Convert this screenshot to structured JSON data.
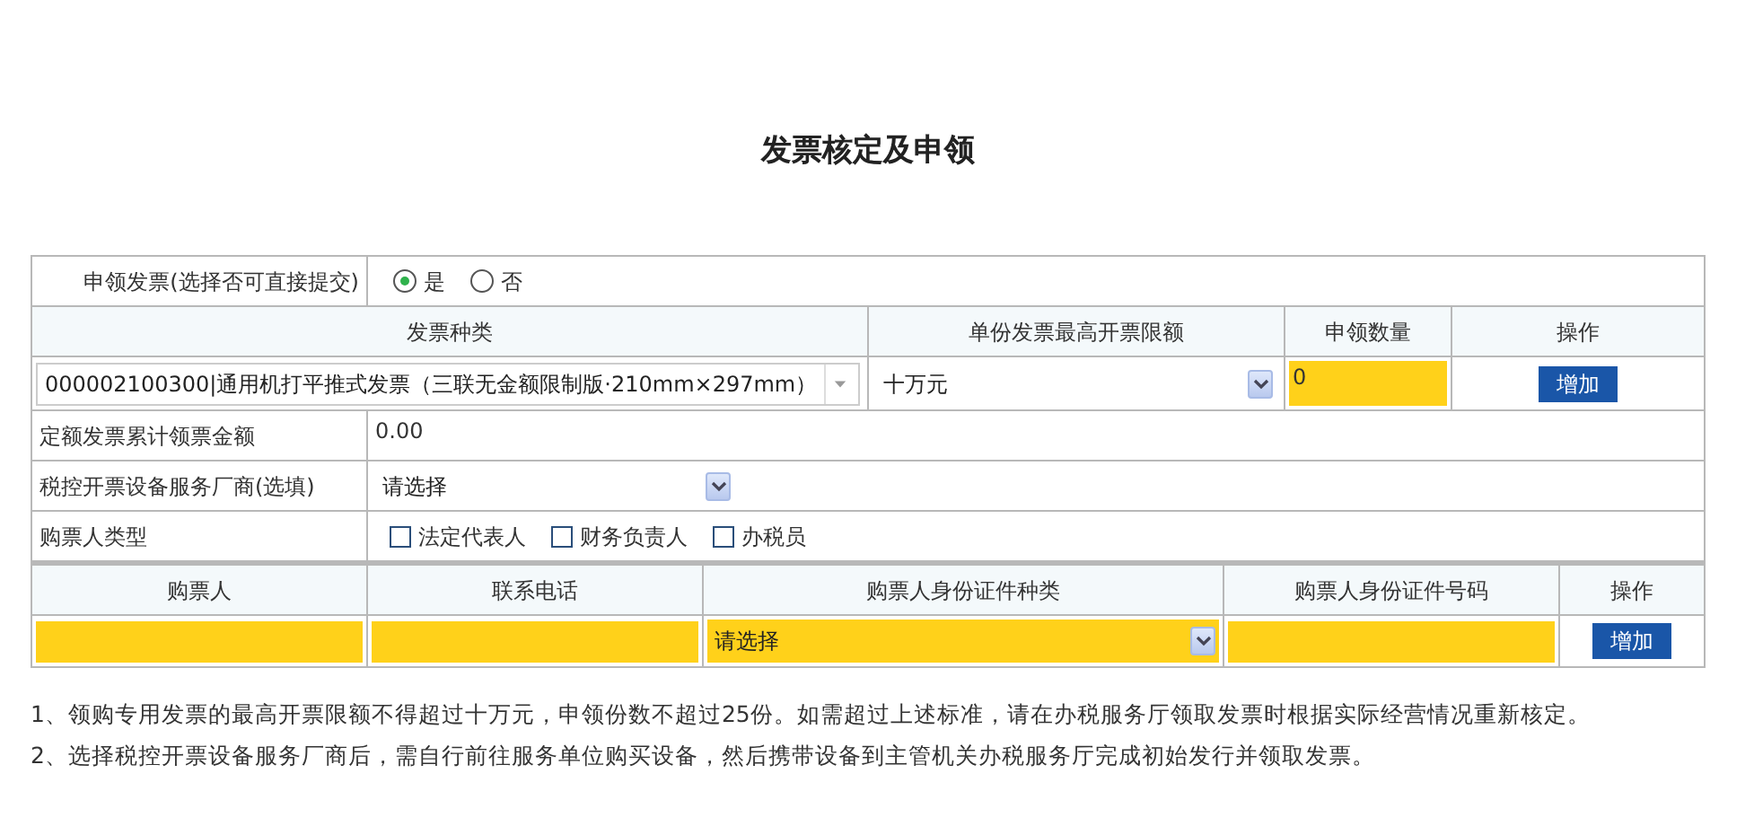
{
  "title": "发票核定及申领",
  "apply": {
    "label": "申领发票(选择否可直接提交)",
    "options": [
      {
        "label": "是",
        "selected": true
      },
      {
        "label": "否",
        "selected": false
      }
    ]
  },
  "invoice_table": {
    "columns": [
      "发票种类",
      "单份发票最高开票限额",
      "申领数量",
      "操作"
    ],
    "rows": [
      {
        "invoice_type": "000002100300|通用机打平推式发票（三联无金额限制版·210mm×297mm）",
        "limit": "十万元",
        "quantity": "0",
        "action": "增加"
      }
    ]
  },
  "fixed_amount": {
    "label": "定额发票累计领票金额",
    "value": "0.00"
  },
  "vendor": {
    "label": "税控开票设备服务厂商(选填)",
    "value": "请选择"
  },
  "buyer_type": {
    "label": "购票人类型",
    "options": [
      {
        "label": "法定代表人",
        "checked": false
      },
      {
        "label": "财务负责人",
        "checked": false
      },
      {
        "label": "办税员",
        "checked": false
      }
    ]
  },
  "buyer_table": {
    "columns": [
      "购票人",
      "联系电话",
      "购票人身份证件种类",
      "购票人身份证件号码",
      "操作"
    ],
    "rows": [
      {
        "id_type": "请选择",
        "action": "增加"
      }
    ]
  },
  "notes": [
    "1、领购专用发票的最高开票限额不得超过十万元，申领份数不超过25份。如需超过上述标准，请在办税服务厅领取发票时根据实际经营情况重新核定。",
    "2、选择税控开票设备服务厂商后，需自行前往服务单位购买设备，然后携带设备到主管机关办税服务厅完成初始发行并领取发票。"
  ]
}
